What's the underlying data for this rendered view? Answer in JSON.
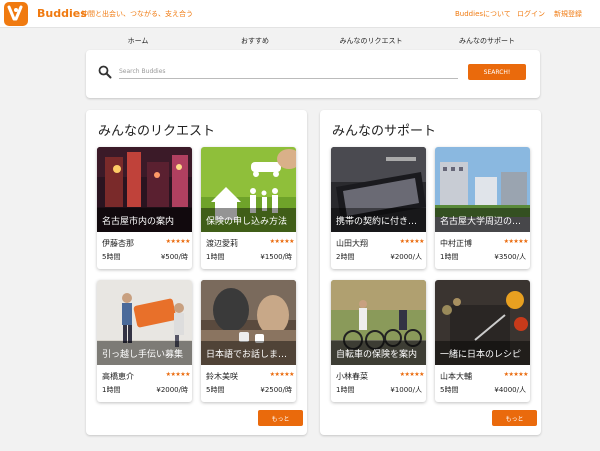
{
  "header": {
    "brand": "Buddies",
    "tagline": "仲間と出会い、つながる、支え合う",
    "links": [
      "Buddiesについて",
      "ログイン",
      "新規登録"
    ]
  },
  "nav": {
    "items": [
      "ホーム",
      "おすすめ",
      "みんなのリクエスト",
      "みんなのサポート"
    ]
  },
  "search": {
    "placeholder": "Search Buddies",
    "button_label": "SEARCH!"
  },
  "colors": {
    "accent": "#ea6a0c",
    "brand": "#f07a10"
  },
  "requests": {
    "title": "みんなのリクエスト",
    "more_label": "もっと",
    "cards": [
      {
        "title": "名古屋市内の案内",
        "name": "伊藤杏那",
        "rating": 5,
        "stars": "★★★★★",
        "hours": "5時間",
        "price": "¥500/時",
        "image": "night-street"
      },
      {
        "title": "保険の申し込み方法",
        "name": "渡辺愛莉",
        "rating": 5,
        "stars": "★★★★★",
        "hours": "1時間",
        "price": "¥1500/時",
        "image": "family-insurance"
      },
      {
        "title": "引っ越し手伝い募集",
        "name": "高橋恵介",
        "rating": 5,
        "stars": "★★★★★",
        "hours": "1時間",
        "price": "¥2000/時",
        "image": "moving-sofa"
      },
      {
        "title": "日本語でお話しましょう",
        "name": "鈴木美咲",
        "rating": 5,
        "stars": "★★★★★",
        "hours": "5時間",
        "price": "¥2500/時",
        "image": "coffee-conversation"
      }
    ]
  },
  "supports": {
    "title": "みんなのサポート",
    "more_label": "もっと",
    "cards": [
      {
        "title": "携帯の契約に付き添い",
        "name": "山田大翔",
        "rating": 5,
        "stars": "★★★★★",
        "hours": "2時間",
        "price": "¥2000/人",
        "image": "laptop"
      },
      {
        "title": "名古屋大学周辺の案内",
        "name": "中村正博",
        "rating": 5,
        "stars": "★★★★★",
        "hours": "1時間",
        "price": "¥3500/人",
        "image": "city-buildings"
      },
      {
        "title": "自転車の保険を案内",
        "name": "小林春菜",
        "rating": 5,
        "stars": "★★★★★",
        "hours": "1時間",
        "price": "¥1000/人",
        "image": "cyclists"
      },
      {
        "title": "一緒に日本のレシピ",
        "name": "山本大輔",
        "rating": 5,
        "stars": "★★★★★",
        "hours": "5時間",
        "price": "¥4000/人",
        "image": "cooking-board"
      }
    ]
  }
}
